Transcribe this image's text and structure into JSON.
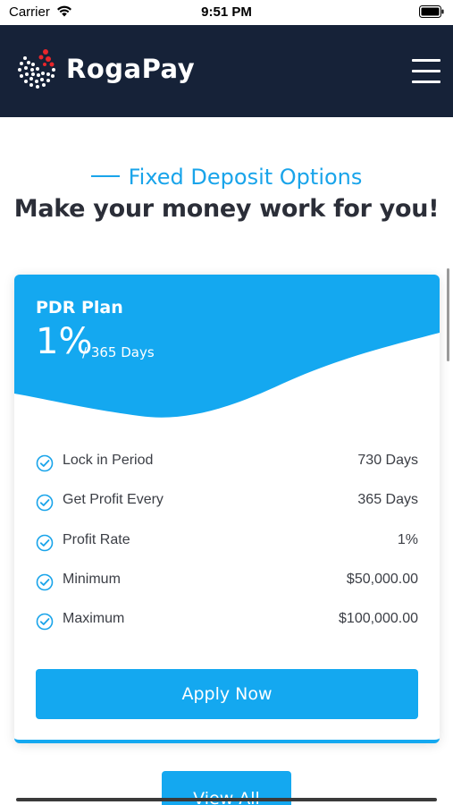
{
  "status_bar": {
    "carrier": "Carrier",
    "time": "9:51 PM",
    "wifi_icon": "wifi-icon",
    "battery_icon": "battery-icon"
  },
  "header": {
    "app_name": "RogaPay",
    "logo_icon": "rogapay-logo-icon",
    "menu_icon": "hamburger-menu-icon",
    "background_color": "#162238"
  },
  "section": {
    "subtitle": "Fixed Deposit Options",
    "title": "Make your money work for you!"
  },
  "plan": {
    "name": "PDR Plan",
    "rate": "1%",
    "duration": "/ 365 Days",
    "accent_color": "#14a8f0",
    "details": [
      {
        "label": "Lock in Period",
        "value": "730 Days",
        "icon": "check-circle-icon"
      },
      {
        "label": "Get Profit Every",
        "value": "365 Days",
        "icon": "check-circle-icon"
      },
      {
        "label": "Profit Rate",
        "value": "1%",
        "icon": "check-circle-icon"
      },
      {
        "label": "Minimum",
        "value": "$50,000.00",
        "icon": "check-circle-icon"
      },
      {
        "label": "Maximum",
        "value": "$100,000.00",
        "icon": "check-circle-icon"
      }
    ],
    "apply_label": "Apply Now"
  },
  "footer": {
    "view_all_label": "View All"
  }
}
